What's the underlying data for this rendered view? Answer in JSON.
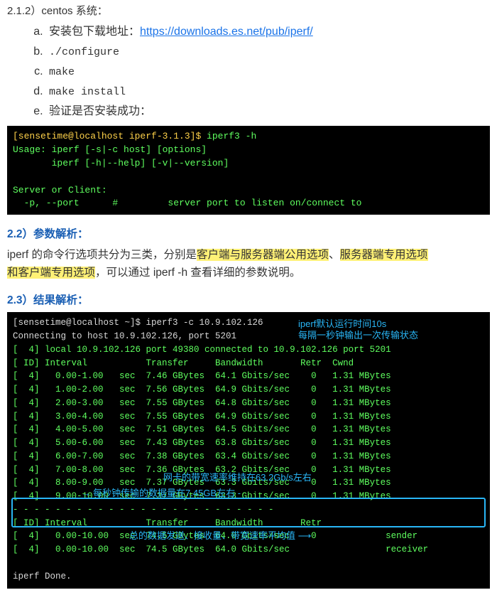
{
  "s21": {
    "num": "2.1.2）centos 系统："
  },
  "list": {
    "a_pre": "安装包下载地址：",
    "a_url": "https://downloads.es.net/pub/iperf/",
    "b": "./configure",
    "c": "make",
    "d": "make install",
    "e": "验证是否安装成功："
  },
  "term1": {
    "prompt": "[sensetime@localhost iperf-3.1.3]$ ",
    "cmd": "iperf3 -h",
    "l2": "Usage: iperf [-s|-c host] [options]",
    "l3": "       iperf [-h|--help] [-v|--version]",
    "l5": "Server or Client:",
    "l6": "  -p, --port      #         server port to listen on/connect to"
  },
  "s22": {
    "title": "2.2）参数解析："
  },
  "para22": {
    "p1a": "iperf 的命令行选项共分为三类，分别是",
    "p1b": "客户端与服务器端公用选项",
    "p1c": "、",
    "p1d": "服务器端专用选项",
    "p2a": "和",
    "p2b": "客户端专用选项",
    "p2c": "，可以通过 iperf -h 查看详细的参数说明。"
  },
  "s23": {
    "title": "2.3）结果解析："
  },
  "term2": {
    "prompt": "[sensetime@localhost ~]$ ",
    "cmd": "iperf3 -c 10.9.102.126",
    "connect": "Connecting to host 10.9.102.126, port 5201",
    "local": "[  4] local 10.9.102.126 port 49380 connected to 10.9.102.126 port 5201",
    "hdr": "[ ID] Interval           Transfer     Bandwidth       Retr  Cwnd",
    "rows": [
      "[  4]   0.00-1.00   sec  7.46 GBytes  64.1 Gbits/sec    0   1.31 MBytes",
      "[  4]   1.00-2.00   sec  7.56 GBytes  64.9 Gbits/sec    0   1.31 MBytes",
      "[  4]   2.00-3.00   sec  7.55 GBytes  64.8 Gbits/sec    0   1.31 MBytes",
      "[  4]   3.00-4.00   sec  7.55 GBytes  64.9 Gbits/sec    0   1.31 MBytes",
      "[  4]   4.00-5.00   sec  7.51 GBytes  64.5 Gbits/sec    0   1.31 MBytes",
      "[  4]   5.00-6.00   sec  7.43 GBytes  63.8 Gbits/sec    0   1.31 MBytes",
      "[  4]   6.00-7.00   sec  7.38 GBytes  63.4 Gbits/sec    0   1.31 MBytes",
      "[  4]   7.00-8.00   sec  7.36 GBytes  63.2 Gbits/sec    0   1.31 MBytes",
      "[  4]   8.00-9.00   sec  7.37 GBytes  63.3 Gbits/sec    0   1.31 MBytes",
      "[  4]   9.00-10.00  sec  7.37 GBytes  63.3 Gbits/sec    0   1.31 MBytes"
    ],
    "dash": "- - - - - - - - - - - - - - - - - - - - - - - - -",
    "hdr2": "[ ID] Interval           Transfer     Bandwidth       Retr",
    "sum1": "[  4]   0.00-10.00  sec  74.5 GBytes  64.0 Gbits/sec    0             sender",
    "sum2": "[  4]   0.00-10.00  sec  74.5 GBytes  64.0 Gbits/sec                  receiver",
    "done": "iperf Done."
  },
  "anno": {
    "a1": "iperf默认运行时间10s",
    "a2": "每隔一秒钟输出一次传输状态",
    "a3": "网卡的带宽速率维持在63.2Gb/s左右",
    "a4_pre": "每秒钟传输的数据量在7.45GB左右",
    "a5": "总的数据发送、接收量、带宽速率平均值"
  }
}
